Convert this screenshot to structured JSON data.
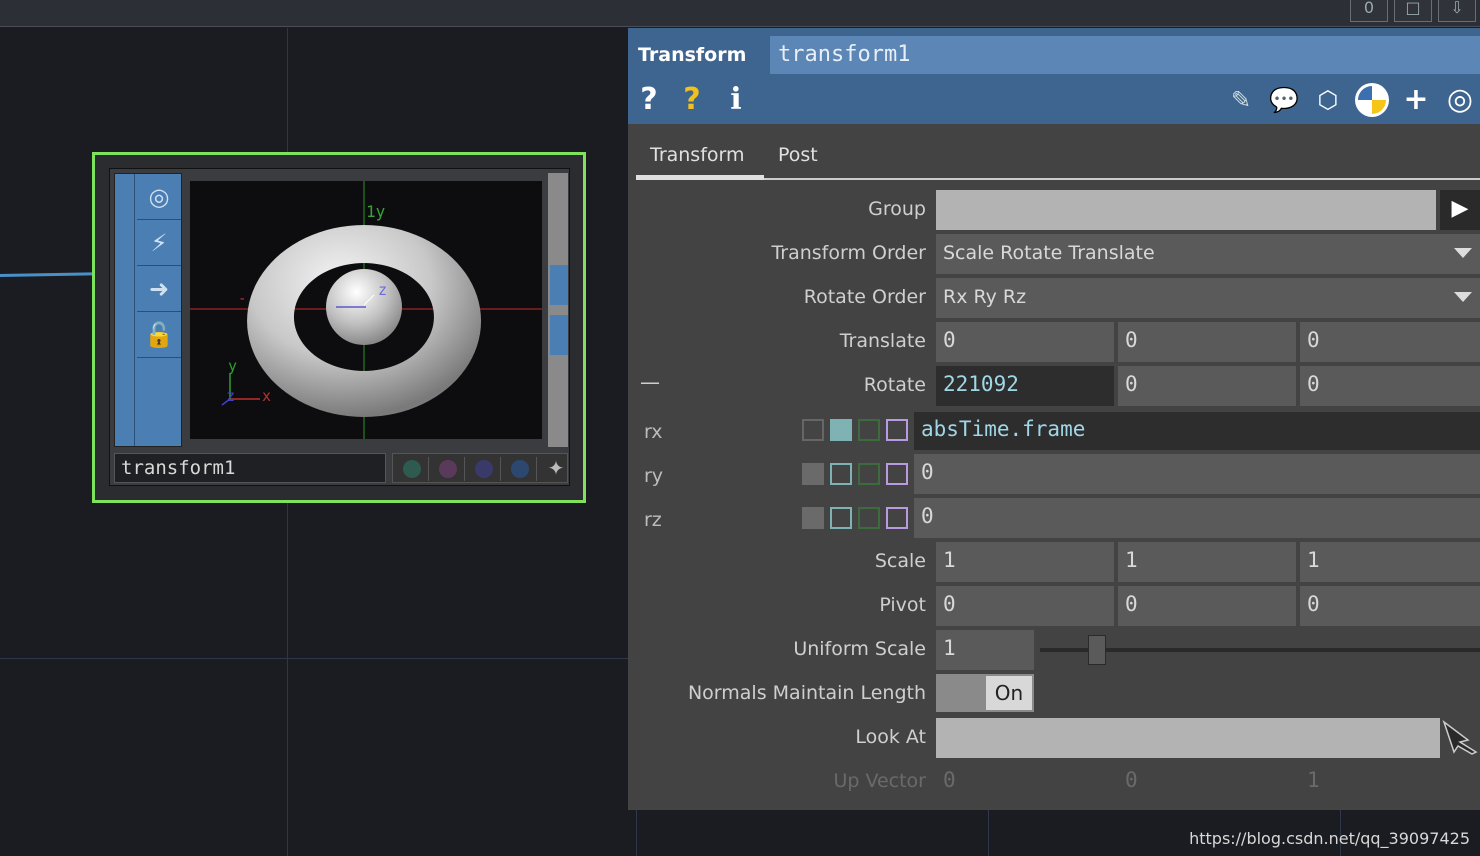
{
  "topbar": {
    "buttons": [
      "0",
      "□",
      "⇩"
    ]
  },
  "node": {
    "name": "transform1",
    "viewer_labels": {
      "y_top": "1y",
      "z_axis": "z",
      "x_small": "x",
      "y_small": "y",
      "z_small": "z",
      "neg": "-"
    }
  },
  "panel": {
    "op_type": "Transform",
    "op_name": "transform1",
    "header_icons": [
      "help-icon",
      "python-help-icon",
      "info-icon",
      "edit-icon",
      "comment-icon",
      "clone-icon",
      "python-icon",
      "add-icon",
      "target-icon"
    ],
    "tabs": [
      "Transform",
      "Post"
    ],
    "params": {
      "group": {
        "label": "Group",
        "value": ""
      },
      "transform_order": {
        "label": "Transform Order",
        "value": "Scale Rotate Translate"
      },
      "rotate_order": {
        "label": "Rotate Order",
        "value": "Rx Ry Rz"
      },
      "translate": {
        "label": "Translate",
        "values": [
          "0",
          "0",
          "0"
        ]
      },
      "rotate": {
        "label": "Rotate",
        "values": [
          "221092",
          "0",
          "0"
        ],
        "collapse": "—"
      },
      "rx": {
        "label": "rx",
        "expr": "absTime.frame"
      },
      "ry": {
        "label": "ry",
        "value": "0"
      },
      "rz": {
        "label": "rz",
        "value": "0"
      },
      "scale": {
        "label": "Scale",
        "values": [
          "1",
          "1",
          "1"
        ]
      },
      "pivot": {
        "label": "Pivot",
        "values": [
          "0",
          "0",
          "0"
        ]
      },
      "uniform_scale": {
        "label": "Uniform Scale",
        "value": "1",
        "slider_fraction": 0.13
      },
      "normals": {
        "label": "Normals Maintain Length",
        "value": "On"
      },
      "look_at": {
        "label": "Look At",
        "value": ""
      },
      "up_vector": {
        "label": "Up Vector",
        "values": [
          "0",
          "0",
          "1"
        ]
      }
    }
  },
  "watermark": "https://blog.csdn.net/qq_39097425",
  "colors": {
    "node_border": "#7ee35a",
    "op_blue": "#4b7eb3",
    "header_blue": "#3e6590"
  }
}
